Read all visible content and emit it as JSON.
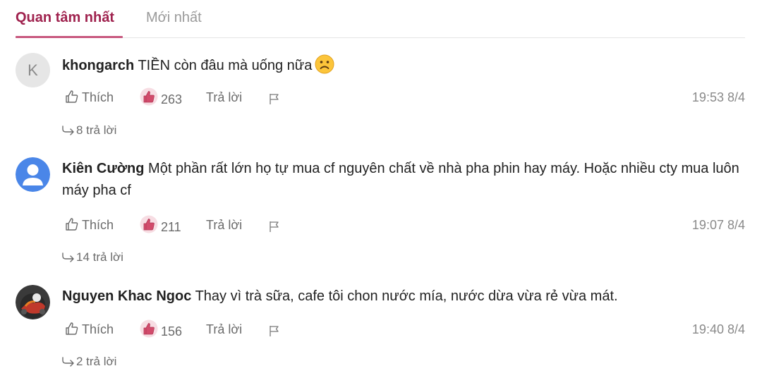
{
  "tabs": {
    "active_label": "Quan tâm nhất",
    "inactive_label": "Mới nhất"
  },
  "colors": {
    "accent": "#9f224e",
    "like_bubble": "#f7dde3",
    "like_hand": "#d24b6b",
    "muted_text": "#6b6b6b"
  },
  "comments": [
    {
      "avatar_letter": "K",
      "author": "khongarch",
      "text": "TIỀN còn đâu mà uống nữa",
      "emoji": "frowning-face",
      "like_label": "Thích",
      "like_count": "263",
      "reply_label": "Trả lời",
      "timestamp": "19:53 8/4",
      "replies_label": "8 trả lời"
    },
    {
      "avatar_type": "default-user",
      "author": "Kiên Cường",
      "text": "Một phần rất lớn họ tự mua cf nguyên chất về nhà pha phin hay máy. Hoặc nhiều cty mua luôn máy pha cf",
      "like_label": "Thích",
      "like_count": "211",
      "reply_label": "Trả lời",
      "timestamp": "19:07 8/4",
      "replies_label": "14 trả lời"
    },
    {
      "avatar_type": "photo-motorbike",
      "author": "Nguyen Khac Ngoc",
      "text": "Thay vì trà sữa, cafe tôi chon nước mía, nước dừa vừa rẻ vừa mát.",
      "like_label": "Thích",
      "like_count": "156",
      "reply_label": "Trả lời",
      "timestamp": "19:40 8/4",
      "replies_label": "2 trả lời"
    }
  ]
}
